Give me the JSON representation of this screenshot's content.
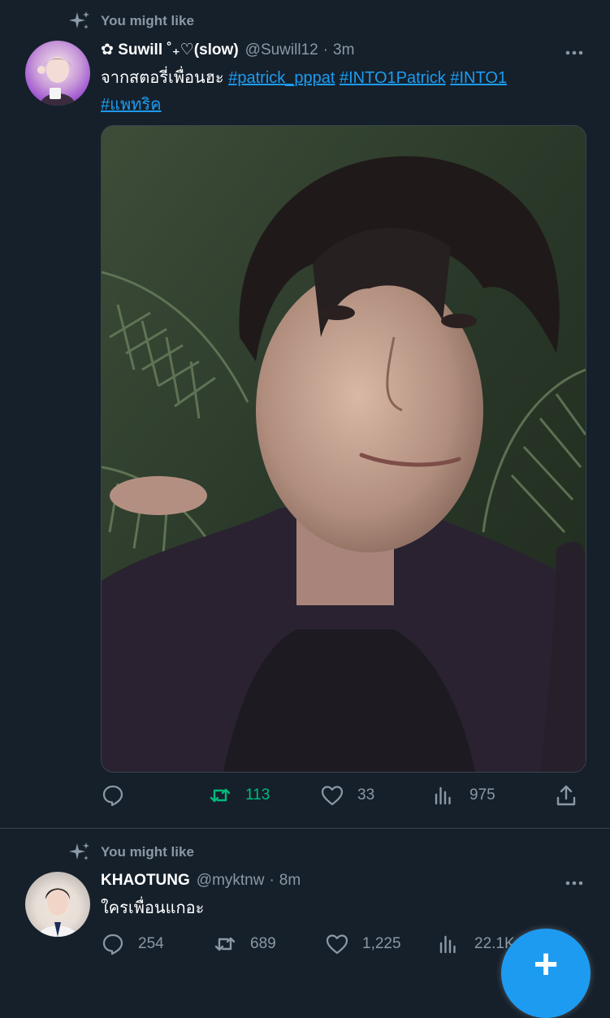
{
  "colors": {
    "background": "#15202b",
    "primary_text": "#ffffff",
    "secondary_text": "#8b98a5",
    "link": "#1d9bf0",
    "retweet_active": "#00ba7c",
    "divider": "#38444d"
  },
  "tweets": [
    {
      "context_label": "You might like",
      "context_icon": "sparkle-icon",
      "display_name": "✿ Suwill ˚₊♡(slow)",
      "handle": "@Suwill12",
      "separator": "·",
      "time": "3m",
      "text_prefix": "จากสตอรี่เพื่อนฮะ",
      "hashtags": [
        "#patrick_pppat",
        "#INTO1Patrick",
        "#INTO1",
        "#แพทริค"
      ],
      "media": "photo",
      "stats": {
        "replies": "",
        "retweets": "113",
        "likes": "33",
        "views": "975"
      }
    },
    {
      "context_label": "You might like",
      "context_icon": "sparkle-icon",
      "display_name": "KHAOTUNG",
      "handle": "@myktnw",
      "separator": "·",
      "time": "8m",
      "text": "ใครเพื่อนแกอะ",
      "stats": {
        "replies": "254",
        "retweets": "689",
        "likes": "1,225",
        "views": "22.1K"
      }
    }
  ],
  "fab": {
    "label": "+",
    "icon": "compose-plus-icon"
  }
}
